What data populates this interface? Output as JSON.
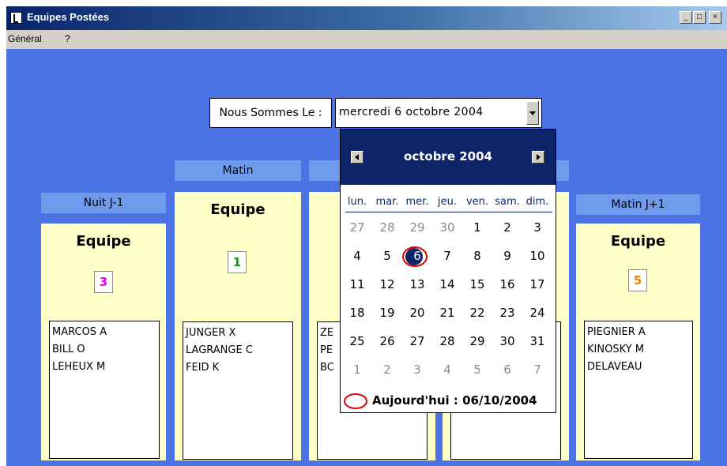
{
  "window": {
    "title": "Equipes Postées",
    "btn_min": "_",
    "btn_max": "□",
    "btn_close": "×"
  },
  "menu": [
    {
      "label": "Général"
    },
    {
      "label": "?"
    }
  ],
  "date_picker": {
    "label": "Nous Sommes Le :",
    "value": "mercredi  6  octobre  2004"
  },
  "shift_headers": {
    "nuit": "Nuit J-1",
    "matin": "Matin",
    "matin_next": "Matin J+1"
  },
  "columns": [
    {
      "equipe_label": "Equipe",
      "team_number": "3",
      "number_color": "#e600e6",
      "names": [
        "MARCOS A",
        "BILL O",
        "LEHEUX M"
      ]
    },
    {
      "equipe_label": "Equipe",
      "team_number": "1",
      "number_color": "#00a000",
      "names": [
        "JUNGER X",
        "LAGRANGE C",
        "FEID K"
      ]
    },
    {
      "equipe_label": "",
      "team_number": "",
      "number_color": "#000000",
      "names": [
        "ZE",
        "PE",
        "BC"
      ]
    },
    {
      "equipe_label": "",
      "team_number": "",
      "number_color": "#000000",
      "names": []
    },
    {
      "equipe_label": "Equipe",
      "team_number": "5",
      "number_color": "#f08000",
      "names": [
        "PIEGNIER A",
        "KINOSKY M",
        "DELAVEAU"
      ]
    }
  ],
  "calendar": {
    "month_label": "octobre 2004",
    "days_of_week": [
      "lun.",
      "mar.",
      "mer.",
      "jeu.",
      "ven.",
      "sam.",
      "dim."
    ],
    "weeks": [
      [
        "27",
        "28",
        "29",
        "30",
        "1",
        "2",
        "3"
      ],
      [
        "4",
        "5",
        "6",
        "7",
        "8",
        "9",
        "10"
      ],
      [
        "11",
        "12",
        "13",
        "14",
        "15",
        "16",
        "17"
      ],
      [
        "18",
        "19",
        "20",
        "21",
        "22",
        "23",
        "24"
      ],
      [
        "25",
        "26",
        "27",
        "28",
        "29",
        "30",
        "31"
      ],
      [
        "1",
        "2",
        "3",
        "4",
        "5",
        "6",
        "7"
      ]
    ],
    "selected_day": "6",
    "today_label": "Aujourd'hui : 06/10/2004"
  },
  "colors": {
    "background": "#4b73e4",
    "column_bg": "#ffffc8",
    "header_bg": "#6f9bec",
    "calendar_header": "#0d2468",
    "today_ring": "#e00000"
  }
}
